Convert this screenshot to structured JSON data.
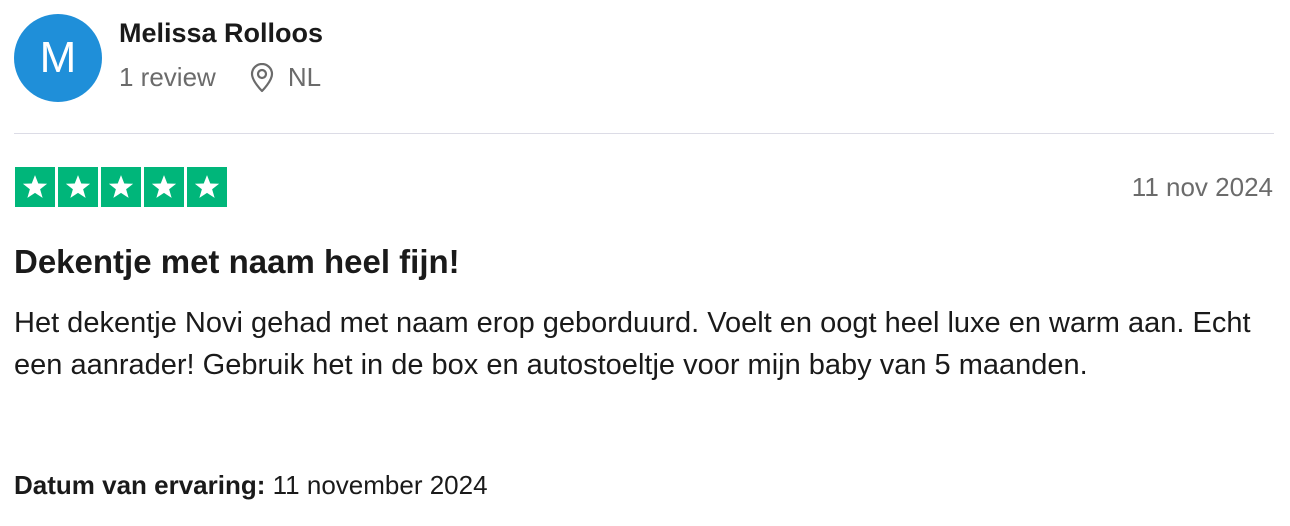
{
  "reviewer": {
    "initial": "M",
    "name": "Melissa Rolloos",
    "review_count": "1 review",
    "location_icon": "location-pin-icon",
    "country": "NL",
    "avatar_color": "#1f8fd9"
  },
  "rating": {
    "stars": 5,
    "max_stars": 5,
    "star_color": "#00b67a",
    "date": "11 nov 2024"
  },
  "review": {
    "title": "Dekentje met naam heel fijn!",
    "body": "Het dekentje Novi gehad met naam erop geborduurd. Voelt en oogt heel luxe en warm aan. Echt een aanrader! Gebruik het in de box en autostoeltje voor mijn baby van 5 maanden.",
    "experience_label": "Datum van ervaring:",
    "experience_date": "11 november 2024"
  }
}
